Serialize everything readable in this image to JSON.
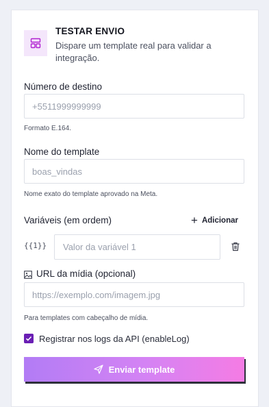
{
  "header": {
    "title": "TESTAR ENVIO",
    "subtitle": "Dispare um template real para validar a integração."
  },
  "destination": {
    "label": "Número de destino",
    "placeholder": "+5511999999999",
    "help": "Formato E.164."
  },
  "template": {
    "label": "Nome do template",
    "placeholder": "boas_vindas",
    "help": "Nome exato do template aprovado na Meta."
  },
  "variables": {
    "label": "Variáveis (em ordem)",
    "add_label": "Adicionar",
    "items": [
      {
        "tag": "{{1}}",
        "placeholder": "Valor da variável 1"
      }
    ]
  },
  "media": {
    "label": "URL da mídia (opcional)",
    "placeholder": "https://exemplo.com/imagem.jpg",
    "help": "Para templates com cabeçalho de mídia."
  },
  "log": {
    "label": "Registrar nos logs da API (enableLog)",
    "checked": true
  },
  "submit": {
    "label": "Enviar template"
  },
  "colors": {
    "accent": "#6a1fb4",
    "gradient_start": "#b27cf5",
    "gradient_end": "#f57ce4"
  }
}
